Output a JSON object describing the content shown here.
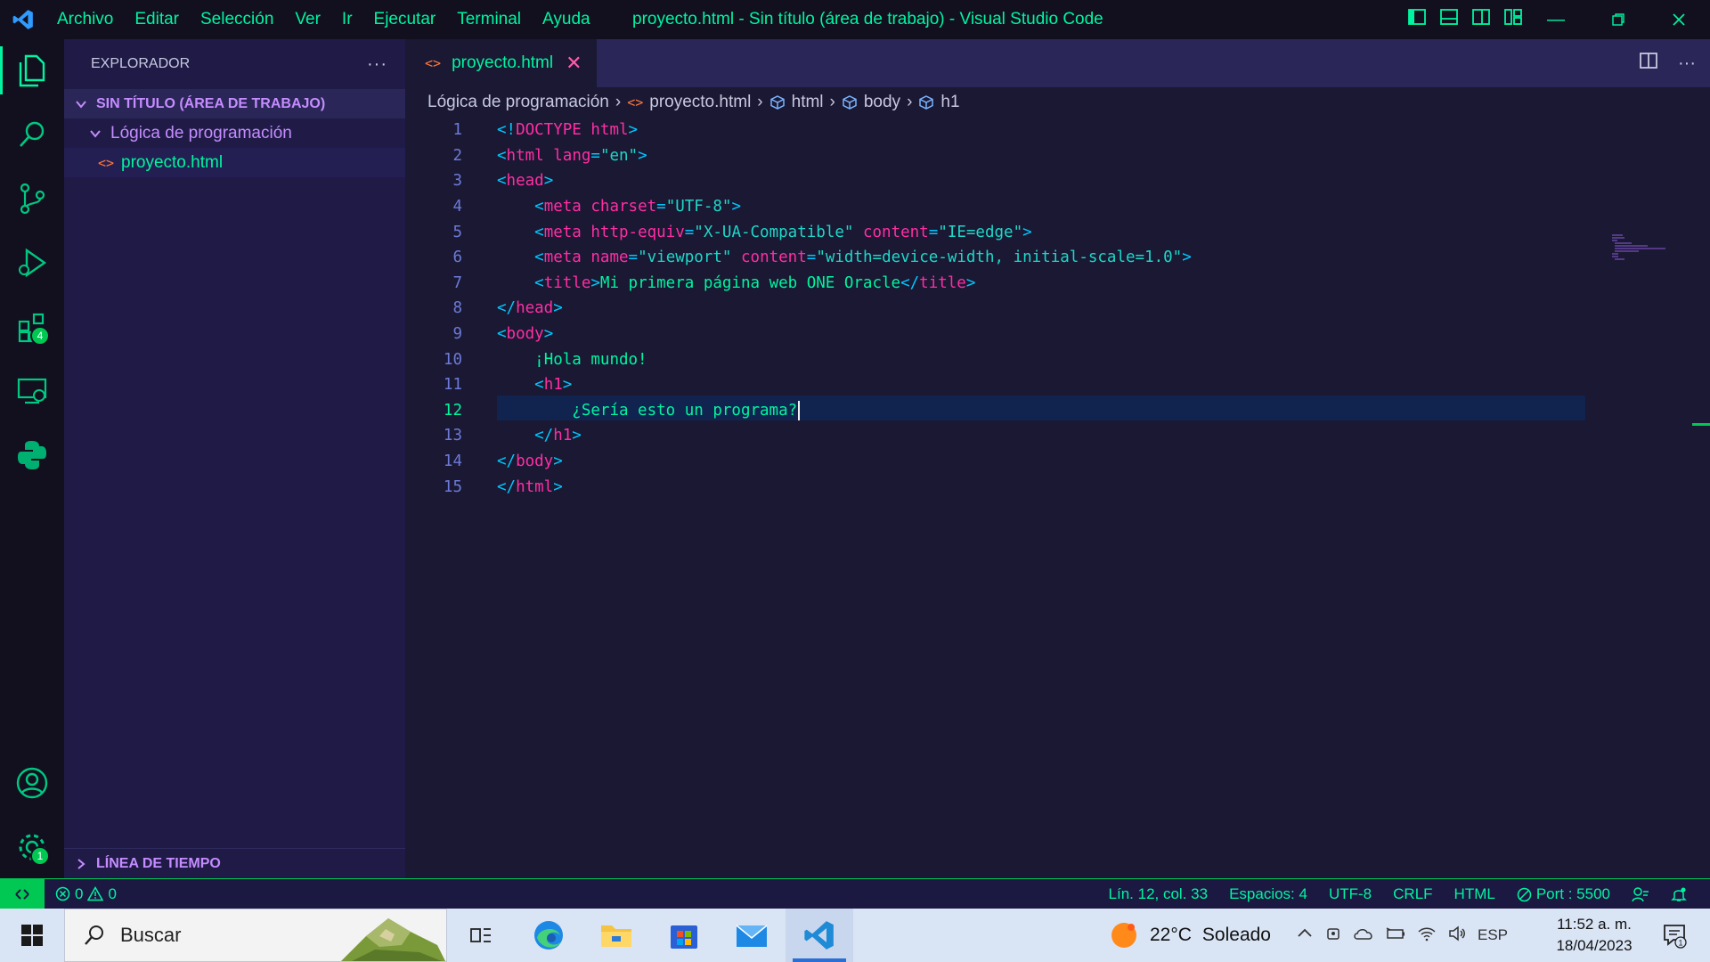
{
  "titlebar": {
    "menu": [
      "Archivo",
      "Editar",
      "Selección",
      "Ver",
      "Ir",
      "Ejecutar",
      "Terminal",
      "Ayuda"
    ],
    "window_title": "proyecto.html - Sin título (área de trabajo) - Visual Studio Code"
  },
  "activity": {
    "extensions_badge": "4",
    "settings_badge": "1"
  },
  "sidebar": {
    "title": "EXPLORADOR",
    "workspace": "SIN TÍTULO (ÁREA DE TRABAJO)",
    "folder": "Lógica de programación",
    "file": "proyecto.html",
    "timeline": "LÍNEA DE TIEMPO"
  },
  "tab": {
    "label": "proyecto.html"
  },
  "breadcrumbs": [
    "Lógica de programación",
    "proyecto.html",
    "html",
    "body",
    "h1"
  ],
  "editor": {
    "current_line": 12,
    "lines": [
      {
        "n": "1",
        "tokens": [
          [
            "p",
            "<!"
          ],
          [
            "tag",
            "DOCTYPE"
          ],
          [
            "p",
            " "
          ],
          [
            "attr",
            "html"
          ],
          [
            "p",
            ">"
          ]
        ]
      },
      {
        "n": "2",
        "tokens": [
          [
            "p",
            "<"
          ],
          [
            "tag",
            "html"
          ],
          [
            "p",
            " "
          ],
          [
            "attr",
            "lang"
          ],
          [
            "p",
            "="
          ],
          [
            "str",
            "\"en\""
          ],
          [
            "p",
            ">"
          ]
        ]
      },
      {
        "n": "3",
        "tokens": [
          [
            "p",
            "<"
          ],
          [
            "tag",
            "head"
          ],
          [
            "p",
            ">"
          ]
        ]
      },
      {
        "n": "4",
        "tokens": [
          [
            "p",
            "    <"
          ],
          [
            "tag",
            "meta"
          ],
          [
            "p",
            " "
          ],
          [
            "attr",
            "charset"
          ],
          [
            "p",
            "="
          ],
          [
            "str",
            "\"UTF-8\""
          ],
          [
            "p",
            ">"
          ]
        ]
      },
      {
        "n": "5",
        "tokens": [
          [
            "p",
            "    <"
          ],
          [
            "tag",
            "meta"
          ],
          [
            "p",
            " "
          ],
          [
            "attr",
            "http-equiv"
          ],
          [
            "p",
            "="
          ],
          [
            "str",
            "\"X-UA-Compatible\""
          ],
          [
            "p",
            " "
          ],
          [
            "attr",
            "content"
          ],
          [
            "p",
            "="
          ],
          [
            "str",
            "\"IE=edge\""
          ],
          [
            "p",
            ">"
          ]
        ]
      },
      {
        "n": "6",
        "tokens": [
          [
            "p",
            "    <"
          ],
          [
            "tag",
            "meta"
          ],
          [
            "p",
            " "
          ],
          [
            "attr",
            "name"
          ],
          [
            "p",
            "="
          ],
          [
            "str",
            "\"viewport\""
          ],
          [
            "p",
            " "
          ],
          [
            "attr",
            "content"
          ],
          [
            "p",
            "="
          ],
          [
            "str",
            "\"width=device-width, initial-scale=1.0\""
          ],
          [
            "p",
            ">"
          ]
        ]
      },
      {
        "n": "7",
        "tokens": [
          [
            "p",
            "    <"
          ],
          [
            "tag",
            "title"
          ],
          [
            "p",
            ">"
          ],
          [
            "txt",
            "Mi primera página web ONE Oracle"
          ],
          [
            "p",
            "</"
          ],
          [
            "tag",
            "title"
          ],
          [
            "p",
            ">"
          ]
        ]
      },
      {
        "n": "8",
        "tokens": [
          [
            "p",
            "</"
          ],
          [
            "tag",
            "head"
          ],
          [
            "p",
            ">"
          ]
        ]
      },
      {
        "n": "9",
        "tokens": [
          [
            "p",
            "<"
          ],
          [
            "tag",
            "body"
          ],
          [
            "p",
            ">"
          ]
        ]
      },
      {
        "n": "10",
        "tokens": [
          [
            "p",
            "    "
          ],
          [
            "txt",
            "¡Hola mundo!"
          ]
        ]
      },
      {
        "n": "11",
        "tokens": [
          [
            "p",
            "    <"
          ],
          [
            "tag",
            "h1"
          ],
          [
            "p",
            ">"
          ]
        ]
      },
      {
        "n": "12",
        "tokens": [
          [
            "p",
            "        "
          ],
          [
            "txt",
            "¿Sería esto un programa?"
          ]
        ]
      },
      {
        "n": "13",
        "tokens": [
          [
            "p",
            "    </"
          ],
          [
            "tag",
            "h1"
          ],
          [
            "p",
            ">"
          ]
        ]
      },
      {
        "n": "14",
        "tokens": [
          [
            "p",
            "</"
          ],
          [
            "tag",
            "body"
          ],
          [
            "p",
            ">"
          ]
        ]
      },
      {
        "n": "15",
        "tokens": [
          [
            "p",
            "</"
          ],
          [
            "tag",
            "html"
          ],
          [
            "p",
            ">"
          ]
        ]
      }
    ]
  },
  "status": {
    "errors": "0",
    "warnings": "0",
    "position": "Lín. 12, col. 33",
    "spaces": "Espacios: 4",
    "encoding": "UTF-8",
    "eol": "CRLF",
    "language": "HTML",
    "port": "Port : 5500"
  },
  "taskbar": {
    "search_placeholder": "Buscar",
    "temperature": "22°C",
    "condition": "Soleado",
    "lang": "ESP",
    "time": "11:52 a. m.",
    "date": "18/04/2023",
    "notif_count": "1"
  },
  "colors": {
    "accent": "#00f5a0",
    "tag": "#ff2ea3",
    "string": "#1dd8c8",
    "punct": "#00c8ff"
  }
}
